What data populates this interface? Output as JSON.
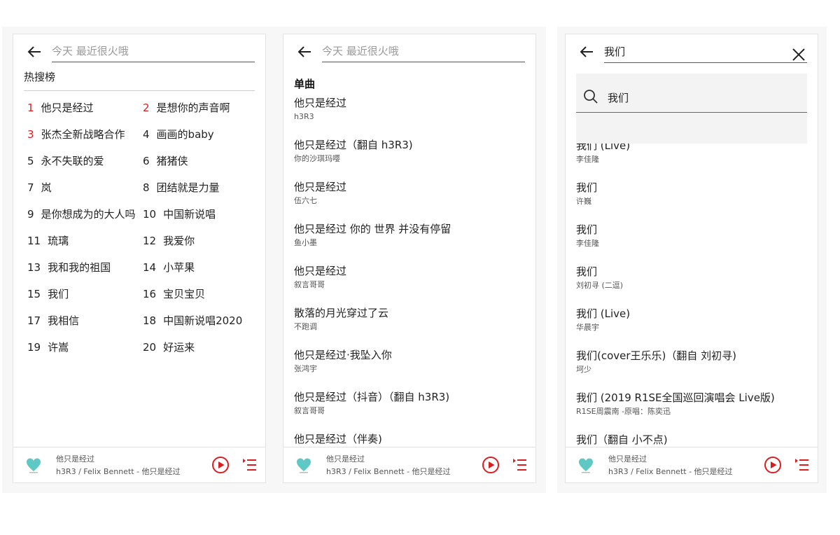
{
  "colors": {
    "accent": "#d81e1e",
    "text": "#222222",
    "muted": "#555555"
  },
  "panel1": {
    "search": {
      "placeholder": "今天 最近很火哦",
      "back_icon": "arrow-left-icon"
    },
    "hot_title": "热搜榜",
    "hot_items": [
      {
        "num": "1",
        "label": "他只是经过"
      },
      {
        "num": "2",
        "label": "是想你的声音啊"
      },
      {
        "num": "3",
        "label": "张杰全新战略合作"
      },
      {
        "num": "4",
        "label": "画画的baby"
      },
      {
        "num": "5",
        "label": "永不失联的爱"
      },
      {
        "num": "6",
        "label": "猪猪侠"
      },
      {
        "num": "7",
        "label": "岚"
      },
      {
        "num": "8",
        "label": "团结就是力量"
      },
      {
        "num": "9",
        "label": "是你想成为的大人吗"
      },
      {
        "num": "10",
        "label": "中国新说唱"
      },
      {
        "num": "11",
        "label": "琉璃"
      },
      {
        "num": "12",
        "label": "我爱你"
      },
      {
        "num": "13",
        "label": "我和我的祖国"
      },
      {
        "num": "14",
        "label": "小苹果"
      },
      {
        "num": "15",
        "label": "我们"
      },
      {
        "num": "16",
        "label": "宝贝宝贝"
      },
      {
        "num": "17",
        "label": "我相信"
      },
      {
        "num": "18",
        "label": "中国新说唱2020"
      },
      {
        "num": "19",
        "label": "许嵩"
      },
      {
        "num": "20",
        "label": "好运来"
      }
    ]
  },
  "panel2": {
    "search": {
      "placeholder": "今天 最近很火哦"
    },
    "section_title": "单曲",
    "songs": [
      {
        "title": "他只是经过",
        "artist": "h3R3"
      },
      {
        "title": "他只是经过（翻自 h3R3)",
        "artist": "你的沙琪玛嘤"
      },
      {
        "title": "他只是经过",
        "artist": "伍六七"
      },
      {
        "title": "他只是经过 你的 世界 并没有停留",
        "artist": "鱼小墨"
      },
      {
        "title": "他只是经过",
        "artist": "叙言哥哥"
      },
      {
        "title": "散落的月光穿过了云",
        "artist": "不跑调"
      },
      {
        "title": "他只是经过·我坠入你",
        "artist": "张鸿宇"
      },
      {
        "title": "他只是经过（抖音）（翻自 h3R3)",
        "artist": "叙言哥哥"
      },
      {
        "title": "他只是经过（伴奏)",
        "artist": ""
      }
    ]
  },
  "panel3": {
    "search": {
      "value": "我们",
      "clear_icon": "close-icon"
    },
    "suggestion": {
      "icon": "search-icon",
      "text": "我们"
    },
    "songs": [
      {
        "title": "我们 (Live)",
        "artist": "李佳隆"
      },
      {
        "title": "我们",
        "artist": "许巍"
      },
      {
        "title": "我们",
        "artist": "李佳隆"
      },
      {
        "title": "我们",
        "artist": "刘初寻 (二逗)"
      },
      {
        "title": "我们 (Live)",
        "artist": "华晨宇"
      },
      {
        "title": "我们(cover王乐乐)（翻自 刘初寻)",
        "artist": "坷少"
      },
      {
        "title": "我们 (2019 R1SE全国巡回演唱会 Live版)",
        "artist": "R1SE周震南 -原唱：陈奕迅"
      },
      {
        "title": "我们（翻自 小不点)",
        "artist": ""
      }
    ]
  },
  "player": {
    "title": "他只是经过",
    "subtitle": "h3R3 / Felix Bennett - 他只是经过",
    "play_icon": "play-circle-icon",
    "queue_icon": "playlist-icon"
  }
}
